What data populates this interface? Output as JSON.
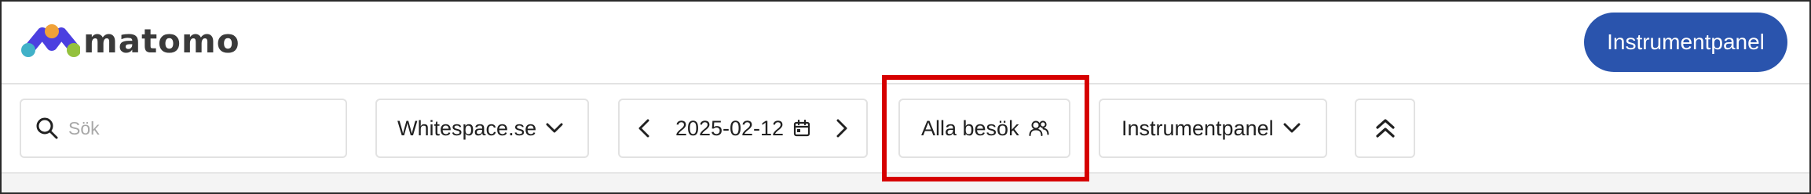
{
  "app": {
    "logo_text": "matomo",
    "cta_label": "Instrumentpanel"
  },
  "controls": {
    "search_placeholder": "Sök",
    "site_label": "Whitespace.se",
    "period_date": "2025-02-12",
    "segment_label": "Alla besök",
    "dashboard_label": "Instrumentpanel"
  },
  "colors": {
    "primary": "#2a54ad",
    "highlight": "#d60000",
    "logo_blue": "#4b3fe0",
    "logo_orange": "#f0a238",
    "logo_teal": "#41b1c8",
    "logo_green": "#94c13d"
  },
  "icons": {
    "search": "search-icon",
    "site_dropdown": "chevron-down-icon",
    "prev": "chevron-left-icon",
    "calendar": "calendar-icon",
    "next": "chevron-right-icon",
    "segment": "users-icon",
    "dashboard_dropdown": "chevron-down-icon",
    "collapse": "double-chevron-up-icon"
  }
}
